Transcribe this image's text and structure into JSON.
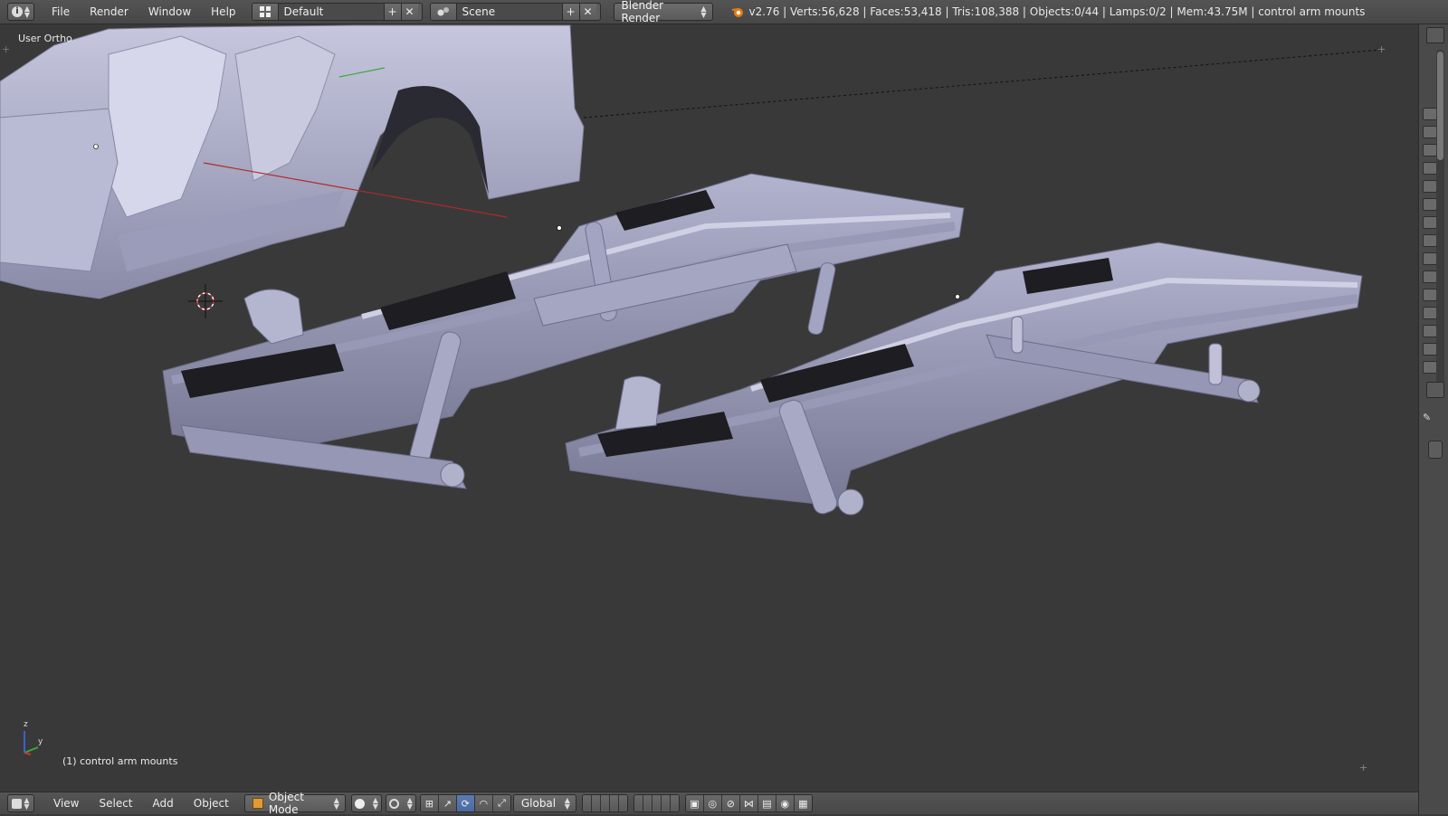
{
  "header": {
    "editor_icon": "info-icon",
    "menus": [
      "File",
      "Render",
      "Window",
      "Help"
    ],
    "layout": {
      "value": "Default"
    },
    "scene": {
      "value": "Scene"
    },
    "engine": {
      "value": "Blender Render"
    },
    "blender_icon": "blender-logo-icon",
    "stats": "v2.76 | Verts:56,628 | Faces:53,418 | Tris:108,388 | Objects:0/44 | Lamps:0/2 | Mem:43.75M | control arm mounts"
  },
  "viewport": {
    "view_name": "User Ortho",
    "active_object": "(1) control arm mounts",
    "axis_labels": {
      "z": "z",
      "y": "y"
    }
  },
  "footer": {
    "editor_icon": "3d-view-editor-icon",
    "menus": [
      "View",
      "Select",
      "Add",
      "Object"
    ],
    "mode": "Object Mode",
    "orientation": "Global"
  },
  "colors": {
    "viewport_bg": "#393939",
    "mesh": "#a7a8c5",
    "mesh_shadow": "#6f7090",
    "accent_blue": "#5a7cb5"
  }
}
